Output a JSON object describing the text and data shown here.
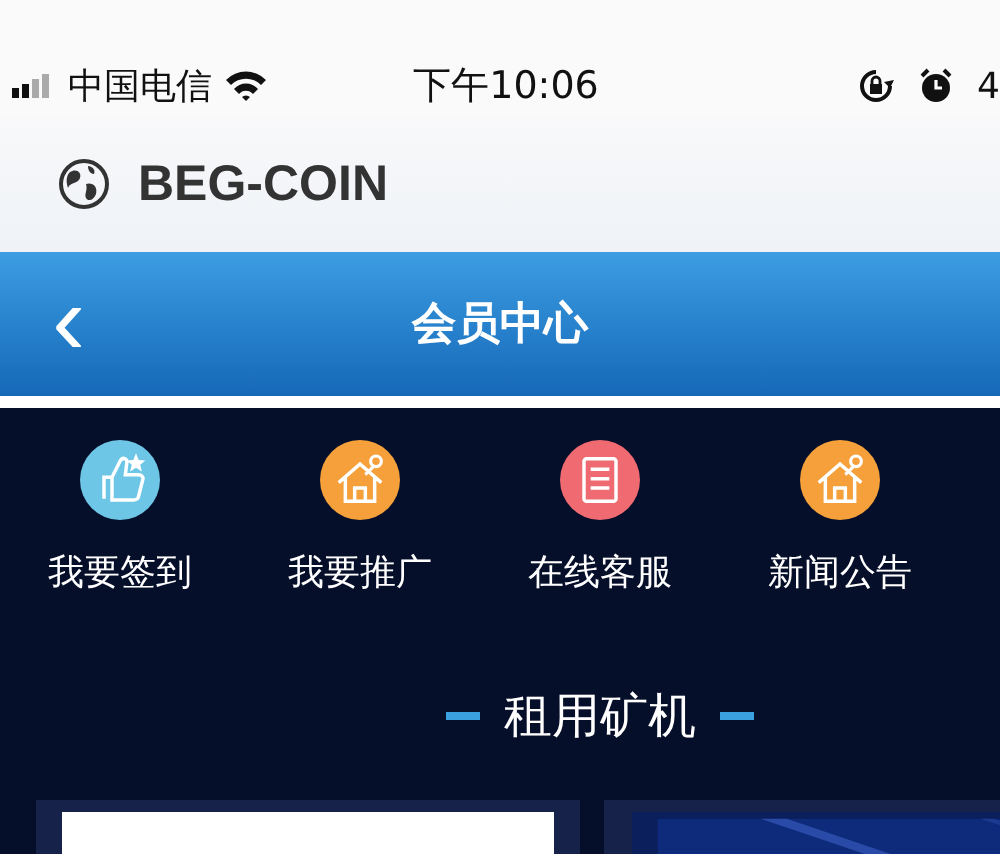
{
  "status_bar": {
    "carrier": "中国电信",
    "time": "下午10:06",
    "battery": "4"
  },
  "browser": {
    "title": "BEG-COIN"
  },
  "header": {
    "back": "‹",
    "title": "会员中心"
  },
  "menu": [
    {
      "label": "我要签到",
      "kind": "thumb",
      "color": "#6ec6e6"
    },
    {
      "label": "我要推广",
      "kind": "house",
      "color": "#f5a03a"
    },
    {
      "label": "在线客服",
      "kind": "list",
      "color": "#f06a72"
    },
    {
      "label": "新闻公告",
      "kind": "house",
      "color": "#f5a03a"
    }
  ],
  "section": {
    "title": "租用矿机"
  },
  "cards": [
    {
      "kind": "blank"
    },
    {
      "kind": "picture"
    }
  ]
}
